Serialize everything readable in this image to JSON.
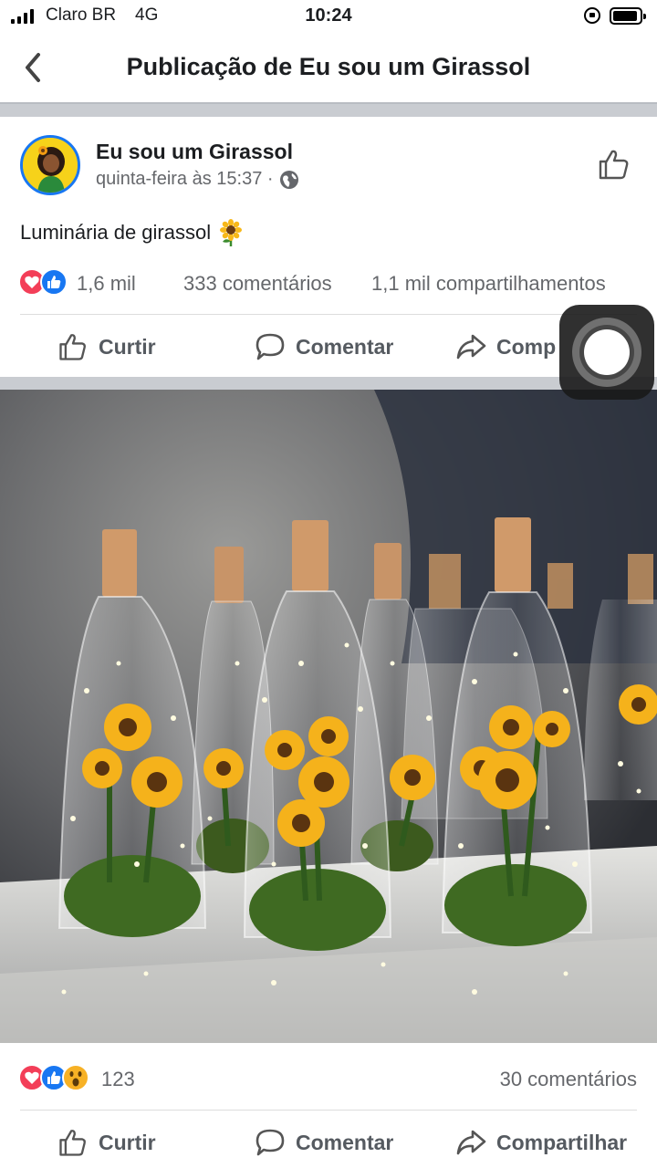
{
  "status_bar": {
    "carrier": "Claro BR",
    "network": "4G",
    "time": "10:24"
  },
  "nav": {
    "title": "Publicação de Eu sou um Girassol",
    "back_icon": "chevron-left-icon"
  },
  "post": {
    "author": "Eu sou um Girassol",
    "timestamp": "quinta-feira às 15:37 ·",
    "privacy_icon": "globe-icon",
    "text": "Luminária de girassol",
    "emoji": "sunflower",
    "reactions_count": "1,6 mil",
    "comments_count": "333 comentários",
    "shares_count": "1,1 mil compartilhamentos",
    "actions": {
      "like": "Curtir",
      "comment": "Comentar",
      "share": "Comp"
    }
  },
  "photo": {
    "reactions_count": "123",
    "comments_count": "30 comentários",
    "actions": {
      "like": "Curtir",
      "comment": "Comentar",
      "share": "Compartilhar"
    }
  },
  "colors": {
    "accent": "#1877f2",
    "love": "#f33e58",
    "wow": "#f7b125",
    "separator": "#c9ccd1"
  }
}
